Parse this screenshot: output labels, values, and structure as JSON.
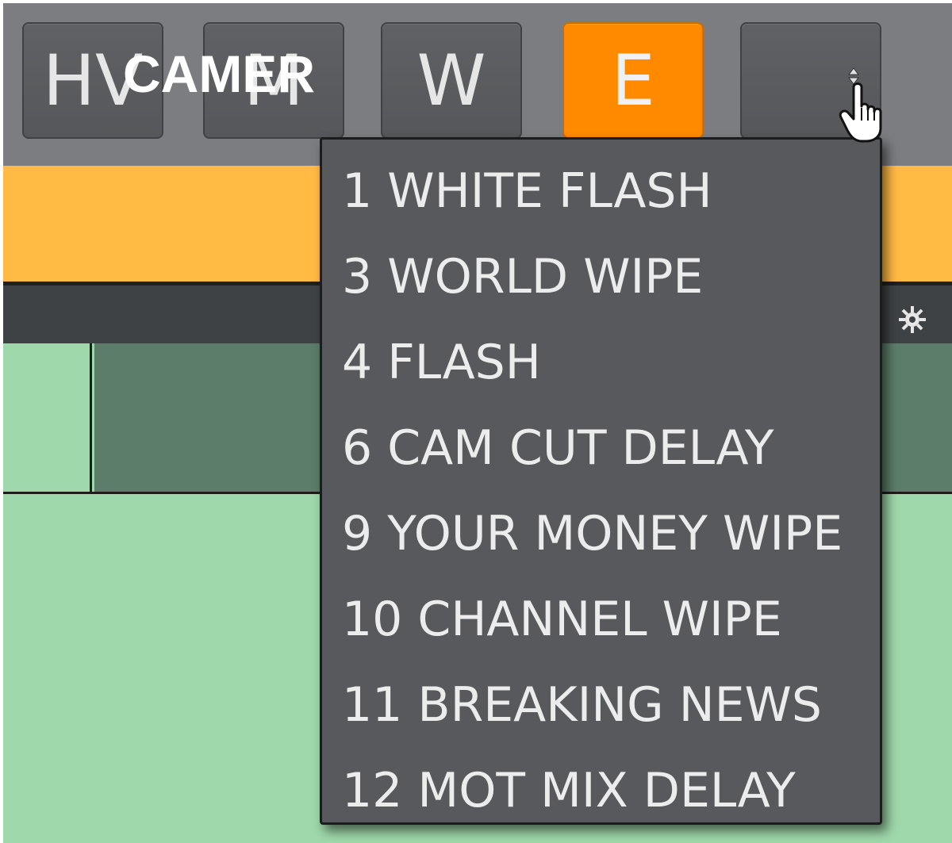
{
  "toolbar": {
    "buttons": [
      {
        "label": "HV",
        "state": "normal"
      },
      {
        "label": "M",
        "state": "normal"
      },
      {
        "label": "W",
        "state": "normal"
      },
      {
        "label": "E",
        "state": "active"
      },
      {
        "label": "",
        "state": "open"
      }
    ],
    "active_color": "#ff8a00"
  },
  "panel": {
    "band_color": "#ffbb44",
    "gear_icon": "gear-icon"
  },
  "camera": {
    "tile_label": "CAMER",
    "tile_color": "#5b7d69",
    "background_color": "#9fd8aa"
  },
  "dropdown": {
    "items": [
      "1 WHITE FLASH",
      "3 WORLD WIPE",
      "4 FLASH",
      "6 CAM CUT DELAY",
      "9 YOUR MONEY WIPE",
      "10 CHANNEL WIPE",
      "11 BREAKING NEWS",
      "12 MOT MIX DELAY"
    ]
  },
  "cursor": {
    "icon": "hand-pointer-icon"
  }
}
